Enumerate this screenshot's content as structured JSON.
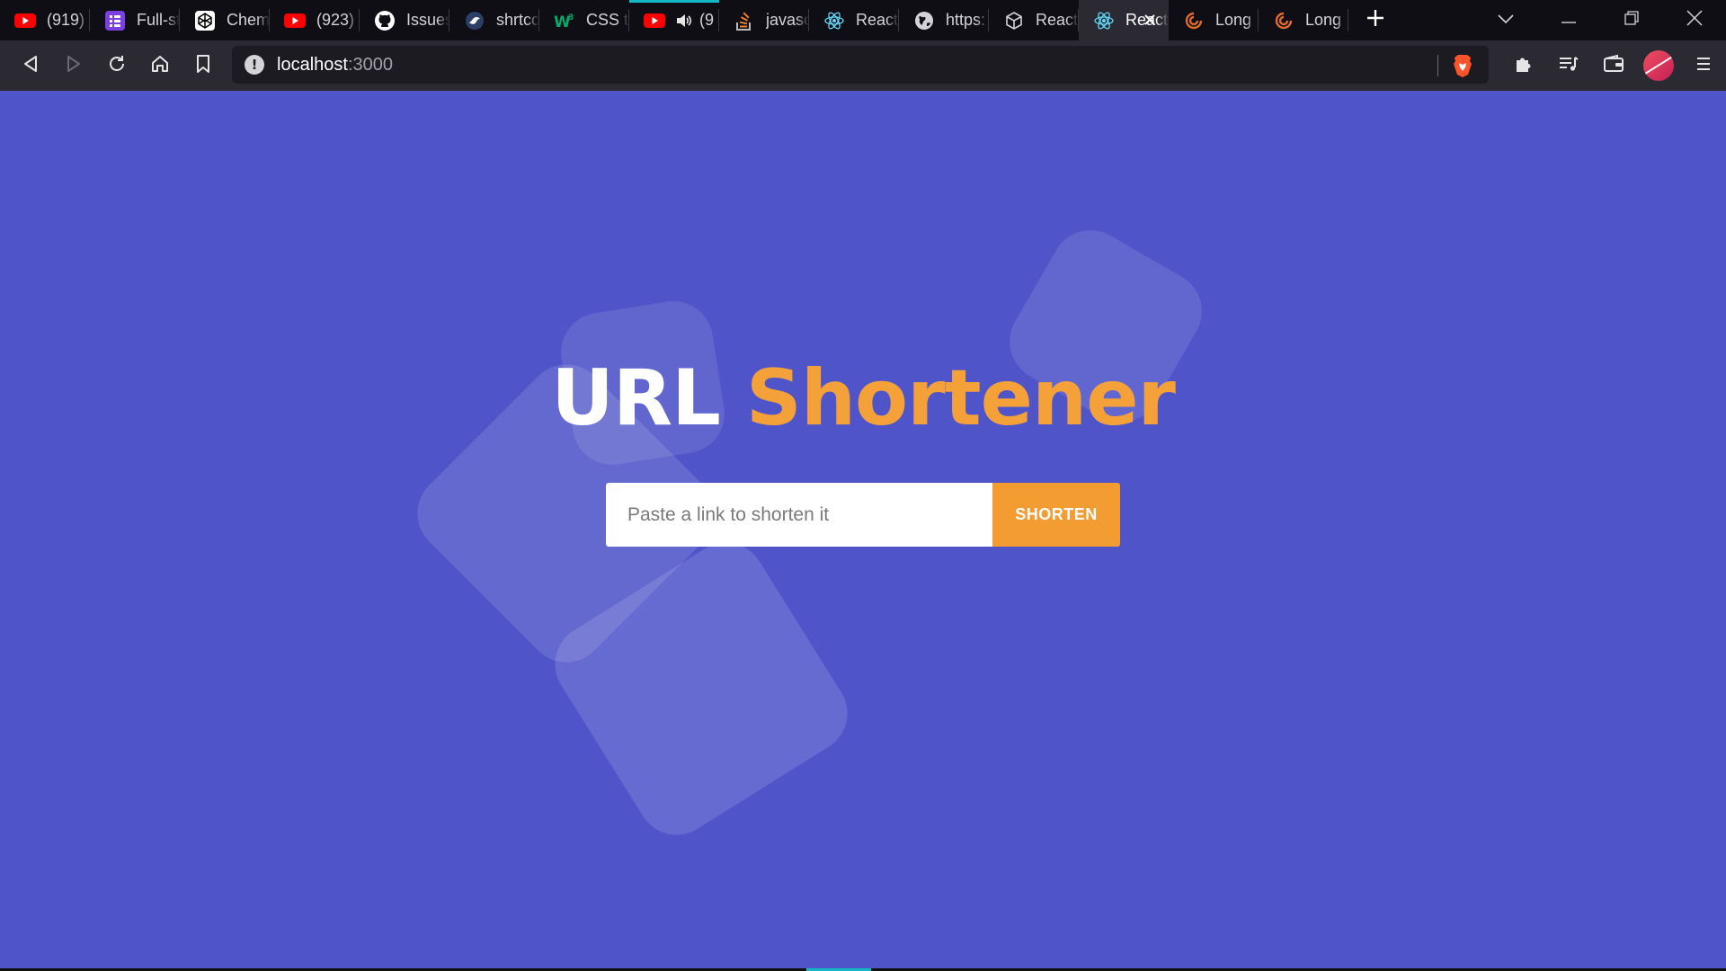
{
  "browser": {
    "tabs": [
      {
        "label": "(919)",
        "icon": "youtube-icon"
      },
      {
        "label": "Full-stack",
        "icon": "list-app-icon"
      },
      {
        "label": "Chemistry",
        "icon": "codepen-icon"
      },
      {
        "label": "(923)",
        "icon": "youtube-icon"
      },
      {
        "label": "Issues",
        "icon": "github-icon"
      },
      {
        "label": "shrtcode",
        "icon": "shrtcode-icon"
      },
      {
        "label": "CSS text",
        "icon": "w3-icon"
      },
      {
        "label": "(9",
        "icon": "youtube-icon",
        "audio": true
      },
      {
        "label": "javascript",
        "icon": "stackoverflow-icon"
      },
      {
        "label": "React",
        "icon": "react-icon"
      },
      {
        "label": "https:",
        "icon": "globe-icon"
      },
      {
        "label": "React",
        "icon": "cube-icon"
      },
      {
        "label": "React",
        "icon": "react-icon",
        "active": true
      },
      {
        "label": "Long",
        "icon": "swirl-icon"
      },
      {
        "label": "Long",
        "icon": "swirl-icon"
      }
    ],
    "address": {
      "host": "localhost",
      "port": ":3000"
    }
  },
  "app": {
    "title_part1": "URL",
    "title_part2": "Shortener",
    "input_placeholder": "Paste a link to shorten it",
    "input_value": "",
    "button_label": "SHORTEN"
  },
  "colors": {
    "background": "#4f55c9",
    "accent": "#f39c32",
    "title_white": "#ffffff"
  }
}
